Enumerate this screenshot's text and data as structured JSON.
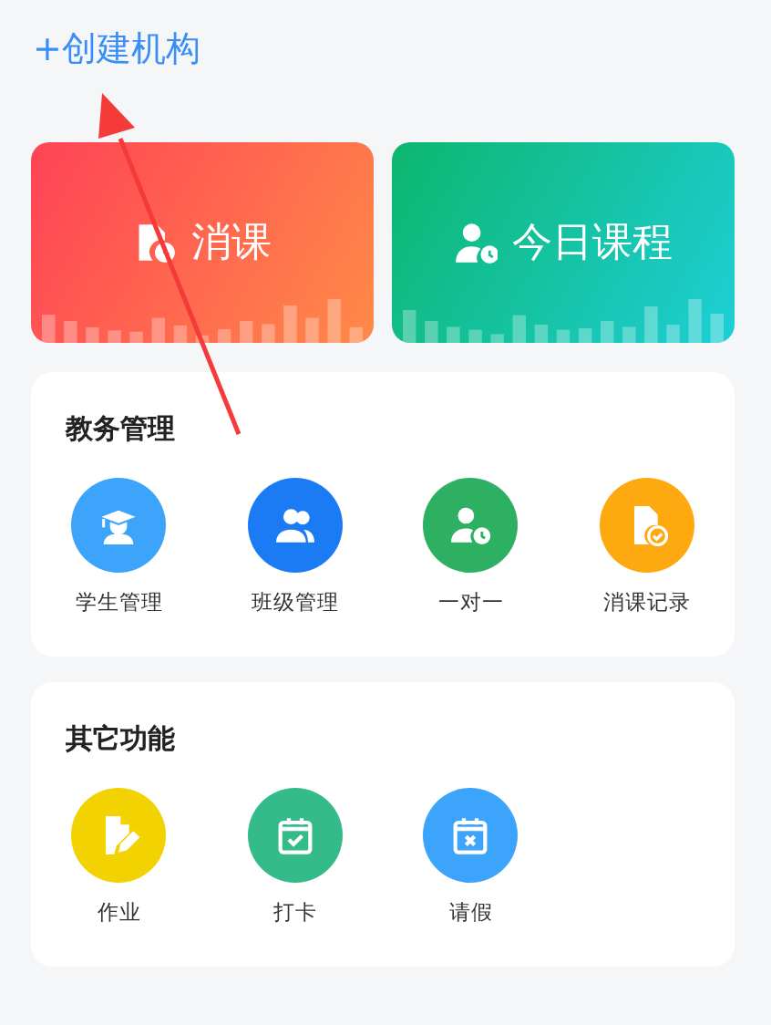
{
  "create_link": "+创建机构",
  "shortcut_cards": [
    {
      "label": "消课"
    },
    {
      "label": "今日课程"
    }
  ],
  "sections": [
    {
      "title": "教务管理",
      "items": [
        {
          "label": "学生管理",
          "color": "#3ca5fb"
        },
        {
          "label": "班级管理",
          "color": "#1a7bf5"
        },
        {
          "label": "一对一",
          "color": "#2eb063"
        },
        {
          "label": "消课记录",
          "color": "#fda90f"
        }
      ]
    },
    {
      "title": "其它功能",
      "items": [
        {
          "label": "作业",
          "color": "#f2d200"
        },
        {
          "label": "打卡",
          "color": "#35bb8a"
        },
        {
          "label": "请假",
          "color": "#3ca5fb"
        }
      ]
    }
  ]
}
